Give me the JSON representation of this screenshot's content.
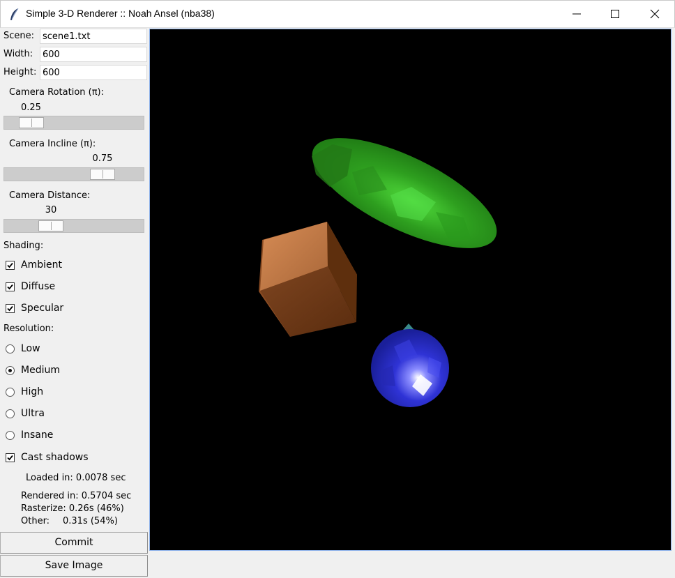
{
  "window": {
    "title": "Simple 3-D Renderer :: Noah Ansel (nba38)",
    "app_icon": "feather-icon",
    "controls": [
      "minimize-icon",
      "maximize-icon",
      "close-icon"
    ]
  },
  "fields": {
    "scene_label": "Scene:",
    "scene_value": "scene1.txt",
    "width_label": "Width:",
    "width_value": "600",
    "height_label": "Height:",
    "height_value": "600"
  },
  "sliders": {
    "rotation": {
      "label": "Camera Rotation (π):",
      "value": "0.25",
      "fraction": 0.125
    },
    "incline": {
      "label": "Camera Incline (π):",
      "value": "0.75",
      "fraction": 0.75
    },
    "distance": {
      "label": "Camera Distance:",
      "value": "30",
      "fraction": 0.3
    }
  },
  "shading": {
    "label": "Shading:",
    "options": [
      {
        "label": "Ambient",
        "checked": true
      },
      {
        "label": "Diffuse",
        "checked": true
      },
      {
        "label": "Specular",
        "checked": true
      }
    ]
  },
  "resolution": {
    "label": "Resolution:",
    "options": [
      "Low",
      "Medium",
      "High",
      "Ultra",
      "Insane"
    ],
    "selected": "Medium"
  },
  "shadows": {
    "label": "Cast shadows",
    "checked": true
  },
  "stats": {
    "loaded": "Loaded in: 0.0078 sec",
    "rendered": "Rendered in: 0.5704 sec",
    "rasterize": "Rasterize: 0.26s (46%)",
    "other_label": "Other:",
    "other_value": "0.31s (54%)"
  },
  "buttons": {
    "commit": "Commit",
    "save": "Save Image"
  },
  "colors": {
    "canvas_background": "#000000",
    "ellipsoid": "#2f9d1c",
    "cube": "#b8693a",
    "sphere": "#2b2fd0"
  }
}
